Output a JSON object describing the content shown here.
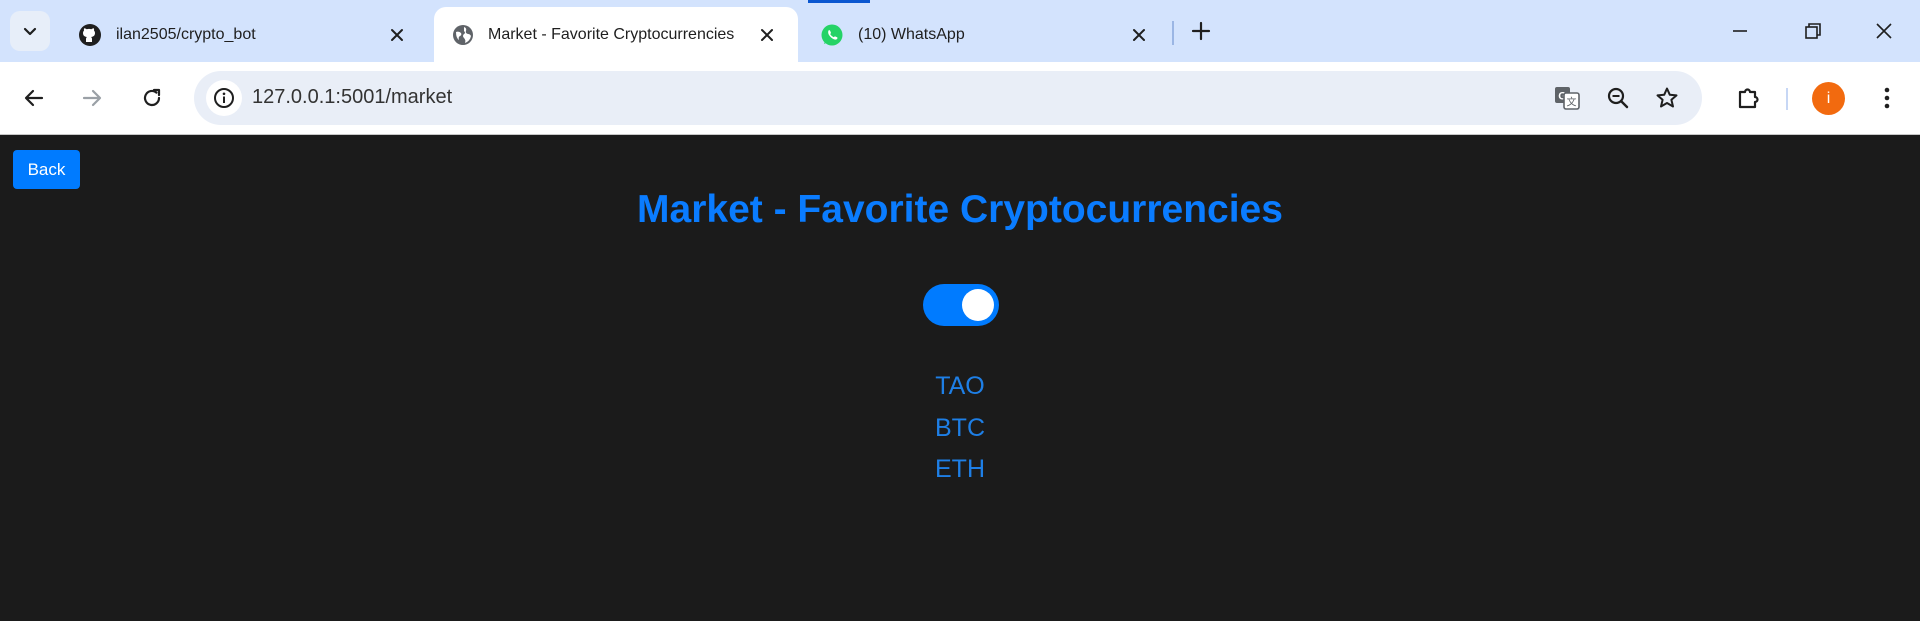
{
  "browser": {
    "tabs": [
      {
        "title": "ilan2505/crypto_bot",
        "icon": "github-icon"
      },
      {
        "title": "Market - Favorite Cryptocurrencies",
        "icon": "globe-icon",
        "active": true
      },
      {
        "title": "(10) WhatsApp",
        "icon": "whatsapp-icon"
      }
    ],
    "url": "127.0.0.1:5001/market",
    "profile_initial": "i",
    "colors": {
      "tabstrip": "#d3e3fd",
      "profile": "#f26a0f"
    }
  },
  "page": {
    "back_label": "Back",
    "title": "Market - Favorite Cryptocurrencies",
    "toggle_on": true,
    "favorites": [
      "TAO",
      "BTC",
      "ETH"
    ],
    "colors": {
      "background": "#1b1b1b",
      "accent": "#007bff",
      "title": "#0a7cff"
    }
  }
}
